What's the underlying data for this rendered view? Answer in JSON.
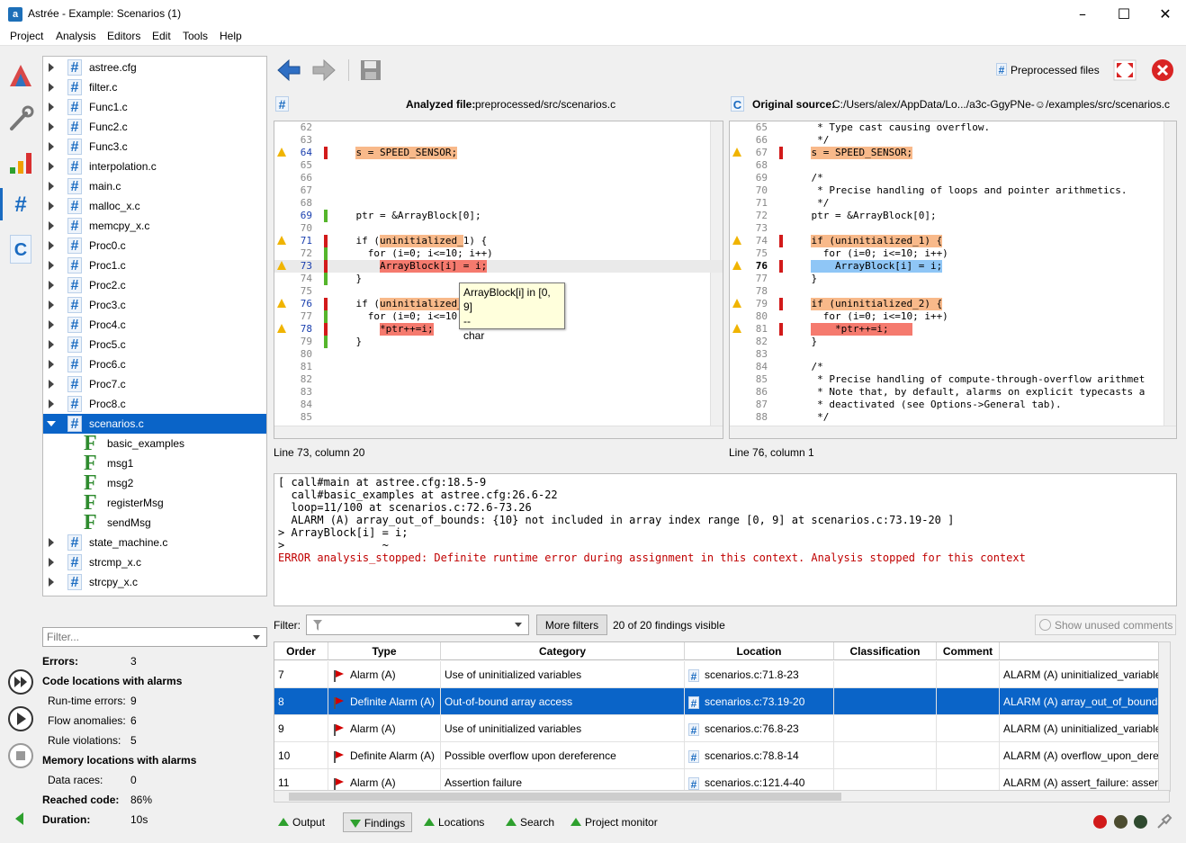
{
  "window": {
    "title": "Astrée - Example: Scenarios (1)",
    "app_icon": "a"
  },
  "menu": [
    "Project",
    "Analysis",
    "Editors",
    "Edit",
    "Tools",
    "Help"
  ],
  "tree": {
    "files": [
      "astree.cfg",
      "filter.c",
      "Func1.c",
      "Func2.c",
      "Func3.c",
      "interpolation.c",
      "main.c",
      "malloc_x.c",
      "memcpy_x.c",
      "Proc0.c",
      "Proc1.c",
      "Proc2.c",
      "Proc3.c",
      "Proc4.c",
      "Proc5.c",
      "Proc6.c",
      "Proc7.c",
      "Proc8.c"
    ],
    "selected": "scenarios.c",
    "functions": [
      "basic_examples",
      "msg1",
      "msg2",
      "registerMsg",
      "sendMsg"
    ],
    "files_after": [
      "state_machine.c",
      "strcmp_x.c",
      "strcpy_x.c"
    ],
    "filter_placeholder": "Filter..."
  },
  "stats": {
    "errors_label": "Errors:",
    "errors_value": "3",
    "code_locations": "Code locations with alarms",
    "runtime_label": "Run-time errors:",
    "runtime_value": "9",
    "flow_label": "Flow anomalies:",
    "flow_value": "6",
    "rule_label": "Rule violations:",
    "rule_value": "5",
    "memory_locations": "Memory locations with alarms",
    "races_label": "Data races:",
    "races_value": "0",
    "reached_label": "Reached code:",
    "reached_value": "86%",
    "duration_label": "Duration:",
    "duration_value": "10s"
  },
  "toolbar": {
    "preprocessed": "Preprocessed files",
    "hash_glyph": "#",
    "c_glyph": "C"
  },
  "left_editor": {
    "header_label": "Analyzed file:",
    "header_path": "preprocessed/src/scenarios.c",
    "status": "Line 73, column 20",
    "lines": [
      {
        "n": "62",
        "t": ""
      },
      {
        "n": "63",
        "t": ""
      },
      {
        "n": "64",
        "t": "    s = SPEED_SENSOR;",
        "warn": true,
        "mk": "red",
        "act": true
      },
      {
        "n": "65",
        "t": ""
      },
      {
        "n": "66",
        "t": ""
      },
      {
        "n": "67",
        "t": ""
      },
      {
        "n": "68",
        "t": ""
      },
      {
        "n": "69",
        "t": "    ptr = &ArrayBlock[0];",
        "mk": "green",
        "act": true
      },
      {
        "n": "70",
        "t": ""
      },
      {
        "n": "71",
        "t": "    if (uninitialized_1) {",
        "warn": true,
        "mk": "red",
        "act": true
      },
      {
        "n": "72",
        "t": "      for (i=0; i<=10; i++)",
        "mk": "green"
      },
      {
        "n": "73",
        "t": "        ArrayBlock[i] = i;",
        "warn": true,
        "mk": "red",
        "act": true
      },
      {
        "n": "74",
        "t": "    }",
        "mk": "green"
      },
      {
        "n": "75",
        "t": ""
      },
      {
        "n": "76",
        "t": "    if (uninitialized_2) {",
        "warn": true,
        "mk": "red",
        "act": true
      },
      {
        "n": "77",
        "t": "      for (i=0; i<=10; i++)",
        "mk": "green"
      },
      {
        "n": "78",
        "t": "        *ptr++=i;",
        "warn": true,
        "mk": "red",
        "act": true
      },
      {
        "n": "79",
        "t": "    }",
        "mk": "green"
      },
      {
        "n": "80",
        "t": ""
      },
      {
        "n": "81",
        "t": ""
      },
      {
        "n": "82",
        "t": ""
      },
      {
        "n": "83",
        "t": ""
      },
      {
        "n": "84",
        "t": ""
      },
      {
        "n": "85",
        "t": ""
      }
    ]
  },
  "right_editor": {
    "header_label": "Original source:",
    "header_path": "C:/Users/alex/AppData/Lo.../a3c-GgyPNe-☺/examples/src/scenarios.c",
    "status": "Line 76, column 1",
    "lines": [
      {
        "n": "65",
        "t": "     * Type cast causing overflow."
      },
      {
        "n": "66",
        "t": "     */"
      },
      {
        "n": "67",
        "t": "    s = SPEED_SENSOR;",
        "warn": true,
        "mk": "red"
      },
      {
        "n": "68",
        "t": ""
      },
      {
        "n": "69",
        "t": "    /*"
      },
      {
        "n": "70",
        "t": "     * Precise handling of loops and pointer arithmetics."
      },
      {
        "n": "71",
        "t": "     */"
      },
      {
        "n": "72",
        "t": "    ptr = &ArrayBlock[0];"
      },
      {
        "n": "73",
        "t": ""
      },
      {
        "n": "74",
        "t": "    if (uninitialized_1) {",
        "warn": true,
        "mk": "red"
      },
      {
        "n": "75",
        "t": "      for (i=0; i<=10; i++)"
      },
      {
        "n": "76",
        "t": "        ArrayBlock[i] = i;",
        "warn": true,
        "mk": "red",
        "cur": true
      },
      {
        "n": "77",
        "t": "    }"
      },
      {
        "n": "78",
        "t": ""
      },
      {
        "n": "79",
        "t": "    if (uninitialized_2) {",
        "warn": true,
        "mk": "red"
      },
      {
        "n": "80",
        "t": "      for (i=0; i<=10; i++)"
      },
      {
        "n": "81",
        "t": "        *ptr++=i;",
        "warn": true,
        "mk": "red"
      },
      {
        "n": "82",
        "t": "    }"
      },
      {
        "n": "83",
        "t": ""
      },
      {
        "n": "84",
        "t": "    /*"
      },
      {
        "n": "85",
        "t": "     * Precise handling of compute-through-overflow arithmet"
      },
      {
        "n": "86",
        "t": "     * Note that, by default, alarms on explicit typecasts a"
      },
      {
        "n": "87",
        "t": "     * deactivated (see Options->General tab)."
      },
      {
        "n": "88",
        "t": "     */"
      }
    ]
  },
  "tooltip": {
    "line1": "ArrayBlock[i] in [0, 9]",
    "line2": "--",
    "line3": "char"
  },
  "output": {
    "lines": [
      "[ call#main at astree.cfg:18.5-9",
      "  call#basic_examples at astree.cfg:26.6-22",
      "  loop=11/100 at scenarios.c:72.6-73.26",
      "  ALARM (A) array_out_of_bounds: {10} not included in array index range [0, 9] at scenarios.c:73.19-20 ]",
      "> ArrayBlock[i] = i;",
      ">               ~"
    ],
    "error": "ERROR analysis_stopped: Definite runtime error during assignment in this context. Analysis stopped for this context"
  },
  "filter_bar": {
    "label": "Filter:",
    "more_filters": "More filters",
    "visible": "20 of 20 findings visible",
    "unused_comments": "Show unused comments"
  },
  "findings": {
    "columns": [
      "Order",
      "Type",
      "Category",
      "Location",
      "Classification",
      "Comment",
      ""
    ],
    "rows": [
      {
        "order": "7",
        "type": "Alarm (A)",
        "category": "Use of uninitialized variables",
        "location": "scenarios.c:71.8-23",
        "classification": "",
        "comment": "",
        "message": "ALARM (A) uninitialized_variable"
      },
      {
        "order": "8",
        "type": "Definite Alarm (A)",
        "category": "Out-of-bound array access",
        "location": "scenarios.c:73.19-20",
        "classification": "",
        "comment": "",
        "message": "ALARM (A) array_out_of_bounds"
      },
      {
        "order": "9",
        "type": "Alarm (A)",
        "category": "Use of uninitialized variables",
        "location": "scenarios.c:76.8-23",
        "classification": "",
        "comment": "",
        "message": "ALARM (A) uninitialized_variable"
      },
      {
        "order": "10",
        "type": "Definite Alarm (A)",
        "category": "Possible overflow upon dereference",
        "location": "scenarios.c:78.8-14",
        "classification": "",
        "comment": "",
        "message": "ALARM (A) overflow_upon_deref"
      },
      {
        "order": "11",
        "type": "Alarm (A)",
        "category": "Assertion failure",
        "location": "scenarios.c:121.4-40",
        "classification": "",
        "comment": "",
        "message": "ALARM (A) assert_failure: assertic"
      }
    ]
  },
  "bottom_tabs": [
    "Output",
    "Findings",
    "Locations",
    "Search",
    "Project monitor"
  ],
  "colors": {
    "selection": "#0a64c8",
    "alarm_red": "#d10000",
    "highlight_orange": "#f8b98a",
    "highlight_red": "#f57a6e",
    "ok_green": "#2ea02e"
  }
}
